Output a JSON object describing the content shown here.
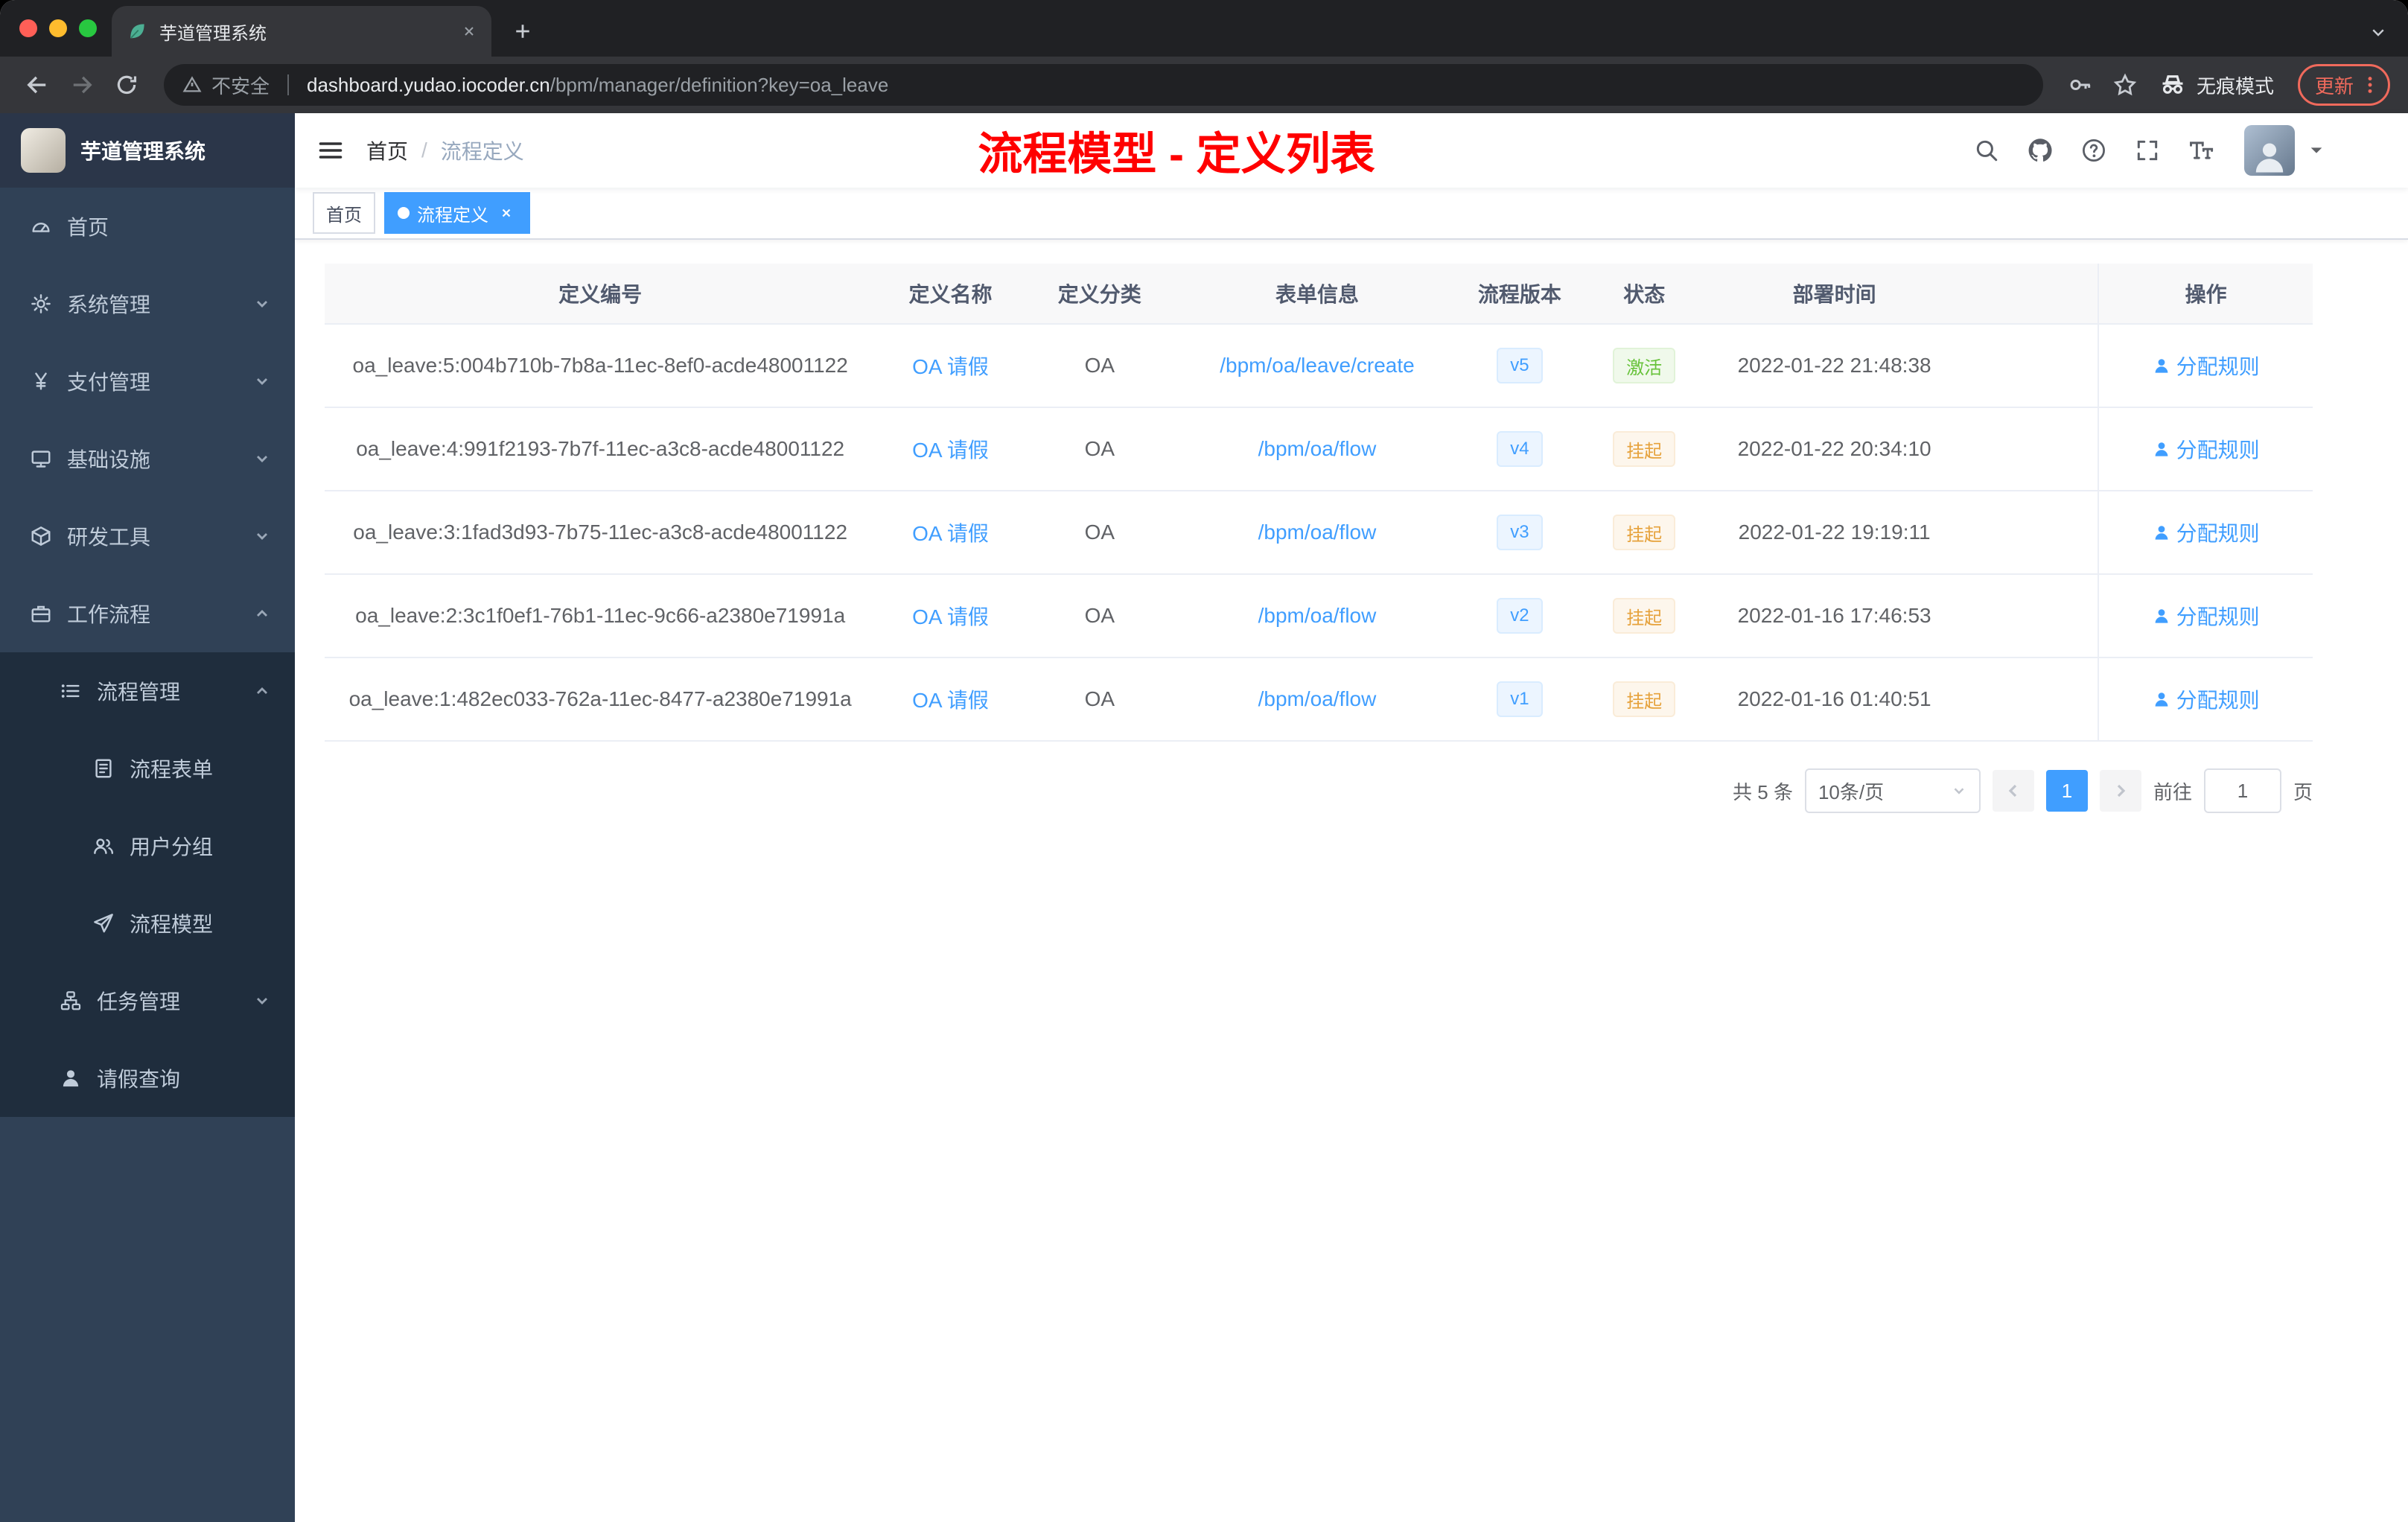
{
  "browser": {
    "tab_title": "芋道管理系统",
    "security_label": "不安全",
    "url_domain": "dashboard.yudao.iocoder.cn",
    "url_path": "/bpm/manager/definition?key=oa_leave",
    "incognito_label": "无痕模式",
    "update_label": "更新"
  },
  "sidebar": {
    "app_title": "芋道管理系统",
    "items": [
      {
        "label": "首页"
      },
      {
        "label": "系统管理"
      },
      {
        "label": "支付管理"
      },
      {
        "label": "基础设施"
      },
      {
        "label": "研发工具"
      },
      {
        "label": "工作流程"
      },
      {
        "label": "流程管理"
      },
      {
        "label": "流程表单"
      },
      {
        "label": "用户分组"
      },
      {
        "label": "流程模型"
      },
      {
        "label": "任务管理"
      },
      {
        "label": "请假查询"
      }
    ]
  },
  "navbar": {
    "breadcrumb_home": "首页",
    "breadcrumb_sep": "/",
    "breadcrumb_current": "流程定义",
    "annotation": "流程模型 - 定义列表"
  },
  "tags": {
    "home": "首页",
    "current": "流程定义"
  },
  "table": {
    "columns": [
      "定义编号",
      "定义名称",
      "定义分类",
      "表单信息",
      "流程版本",
      "状态",
      "部署时间",
      "操作"
    ],
    "action_label": "分配规则",
    "rows": [
      {
        "id": "oa_leave:5:004b710b-7b8a-11ec-8ef0-acde48001122",
        "name": "OA 请假",
        "category": "OA",
        "form": "/bpm/oa/leave/create",
        "version": "v5",
        "status": "激活",
        "time": "2022-01-22 21:48:38"
      },
      {
        "id": "oa_leave:4:991f2193-7b7f-11ec-a3c8-acde48001122",
        "name": "OA 请假",
        "category": "OA",
        "form": "/bpm/oa/flow",
        "version": "v4",
        "status": "挂起",
        "time": "2022-01-22 20:34:10"
      },
      {
        "id": "oa_leave:3:1fad3d93-7b75-11ec-a3c8-acde48001122",
        "name": "OA 请假",
        "category": "OA",
        "form": "/bpm/oa/flow",
        "version": "v3",
        "status": "挂起",
        "time": "2022-01-22 19:19:11"
      },
      {
        "id": "oa_leave:2:3c1f0ef1-76b1-11ec-9c66-a2380e71991a",
        "name": "OA 请假",
        "category": "OA",
        "form": "/bpm/oa/flow",
        "version": "v2",
        "status": "挂起",
        "time": "2022-01-16 17:46:53"
      },
      {
        "id": "oa_leave:1:482ec033-762a-11ec-8477-a2380e71991a",
        "name": "OA 请假",
        "category": "OA",
        "form": "/bpm/oa/flow",
        "version": "v1",
        "status": "挂起",
        "time": "2022-01-16 01:40:51"
      }
    ]
  },
  "pagination": {
    "total": "共 5 条",
    "page_size": "10条/页",
    "current_page": "1",
    "goto_label": "前往",
    "goto_value": "1",
    "goto_unit": "页"
  },
  "colors": {
    "accent": "#409eff",
    "success": "#67c23a",
    "warning": "#e6a23c",
    "sidebar_bg": "#304156",
    "annotation_red": "#ff0000"
  }
}
